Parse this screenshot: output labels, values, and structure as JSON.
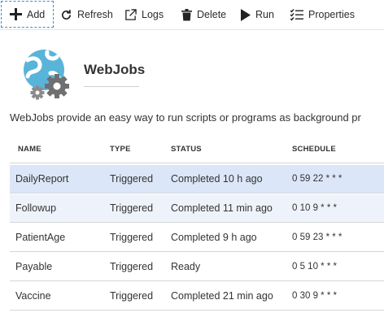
{
  "toolbar": {
    "add": "Add",
    "refresh": "Refresh",
    "logs": "Logs",
    "delete": "Delete",
    "run": "Run",
    "properties": "Properties"
  },
  "header": {
    "title": "WebJobs",
    "description": "WebJobs provide an easy way to run scripts or programs as background pr"
  },
  "table": {
    "columns": [
      "NAME",
      "TYPE",
      "STATUS",
      "SCHEDULE"
    ],
    "rows": [
      {
        "name": "DailyReport",
        "type": "Triggered",
        "status": "Completed 10 h ago",
        "schedule": "0 59 22 * * *"
      },
      {
        "name": "Followup",
        "type": "Triggered",
        "status": "Completed 11 min ago",
        "schedule": "0 10 9 * * *"
      },
      {
        "name": "PatientAge",
        "type": "Triggered",
        "status": "Completed 9 h ago",
        "schedule": "0 59 23 * * *"
      },
      {
        "name": "Payable",
        "type": "Triggered",
        "status": "Ready",
        "schedule": "0 5 10 * * *"
      },
      {
        "name": "Vaccine",
        "type": "Triggered",
        "status": "Completed 21 min ago",
        "schedule": "0 30 9 * * *"
      }
    ]
  },
  "colors": {
    "selected_row": "#dbe6f8",
    "hover_row": "#eef3fb",
    "accent": "#3a8fd8",
    "logo_blue": "#59b4d9",
    "gear_gray": "#7a7a7a"
  },
  "icons": {
    "add": "plus-icon",
    "refresh": "refresh-icon",
    "logs": "external-link-icon",
    "delete": "trash-icon",
    "run": "play-icon",
    "properties": "list-icon",
    "logo": "webjobs-globe-gears-icon"
  }
}
